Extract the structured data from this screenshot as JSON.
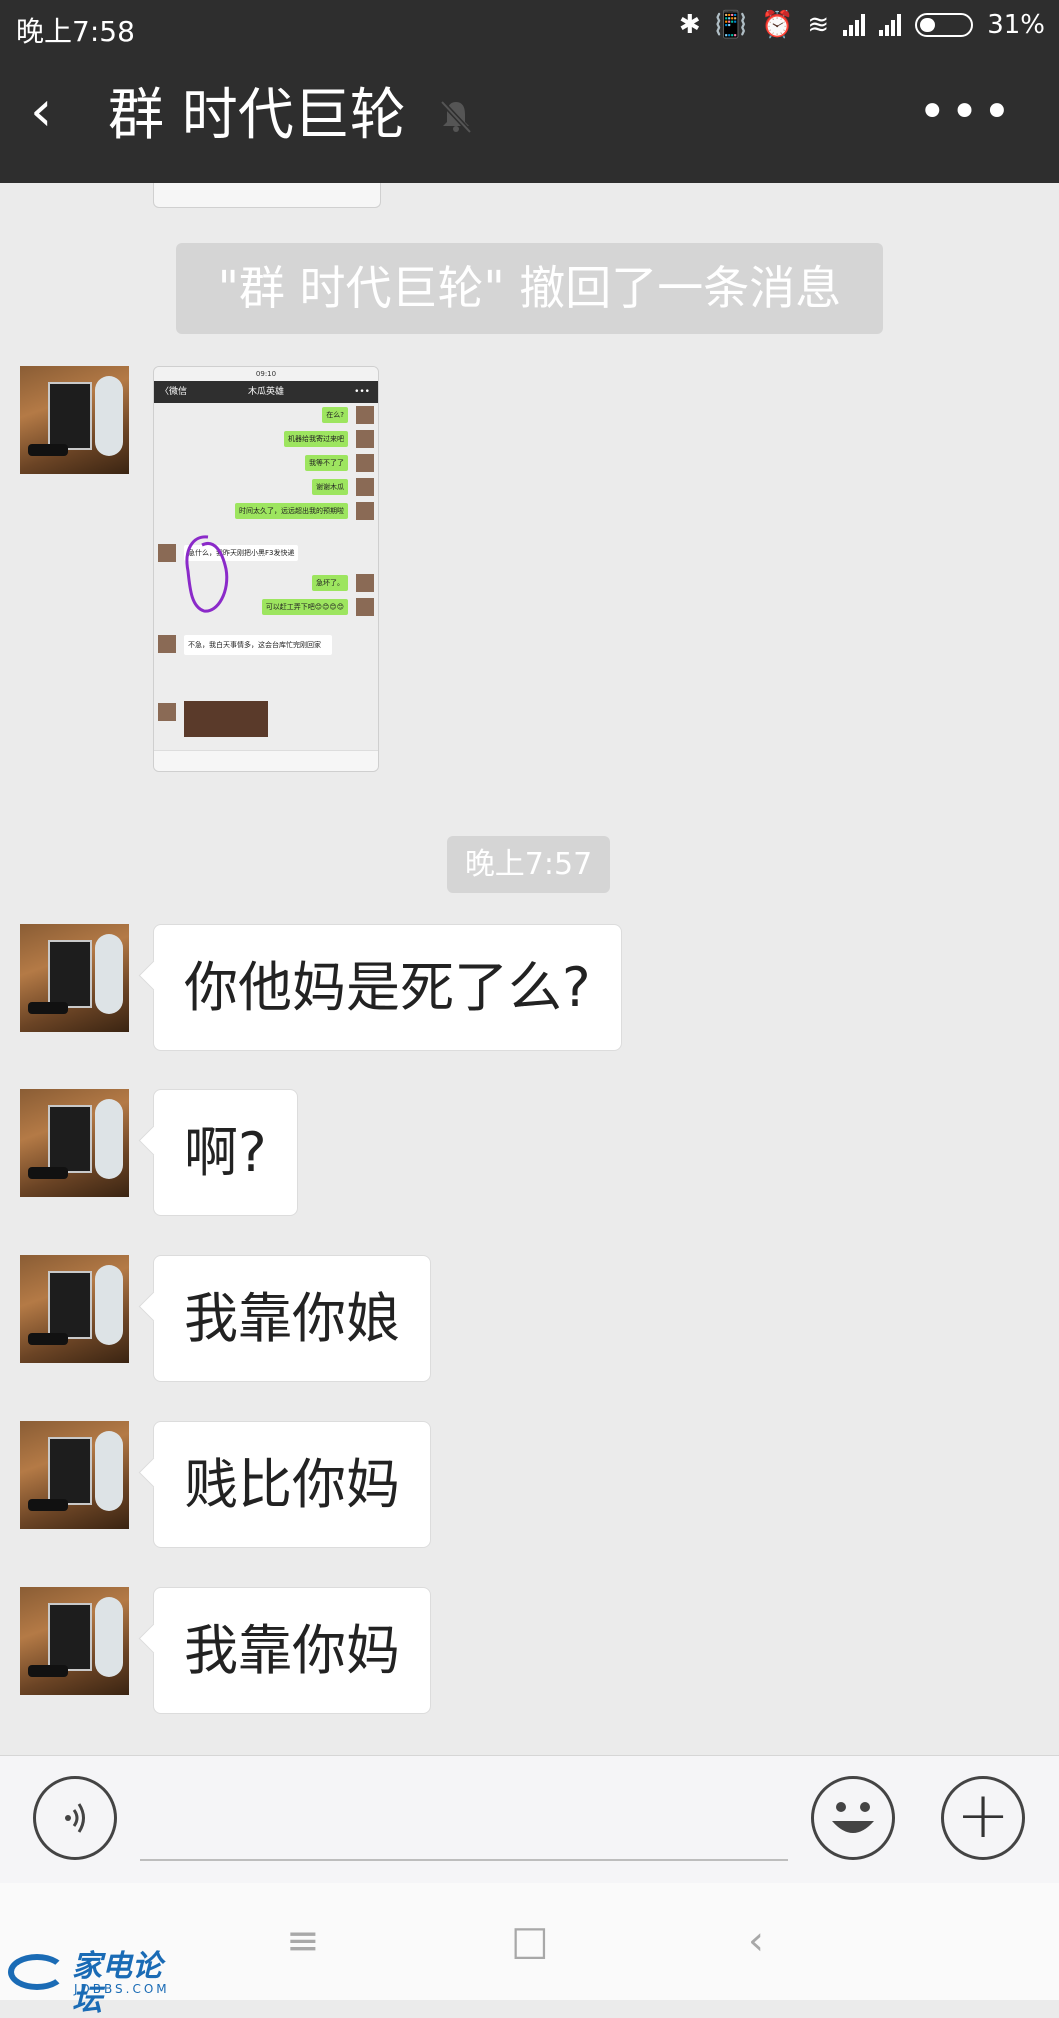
{
  "status_bar": {
    "time": "晚上7:58",
    "battery": "31%",
    "battery_level": 0.31,
    "icons": [
      "bluetooth-icon",
      "vibrate-icon",
      "alarm-icon",
      "wifi-icon",
      "signal-icon",
      "signal-icon",
      "battery-icon"
    ]
  },
  "header": {
    "back_icon": "‹",
    "title": "群 时代巨轮",
    "more_icon": "•••"
  },
  "messages": {
    "recall_notice": "\"群 时代巨轮\" 撤回了一条消息",
    "timestamp": "晚上7:57",
    "texts": [
      {
        "text": "你他妈是死了么?"
      },
      {
        "text": "啊?"
      },
      {
        "text": "我靠你娘"
      },
      {
        "text": "贱比你妈"
      },
      {
        "text": "我靠你妈"
      }
    ]
  },
  "image_message": {
    "status": "09:10",
    "header_back": "〈微信",
    "header_title": "木瓜英雄",
    "header_more": "•••",
    "lines": [
      "在么?",
      "机器给我寄过来吧",
      "我等不了了",
      "谢谢木瓜",
      "时间太久了，远远超出我的预期啦",
      "急什么，我昨天刚把小黑F3发快递",
      "急坏了。",
      "可以赶工弄下吧😊😊😊😊",
      "不急，我白天事情多，这会台库忙完刚回家"
    ]
  },
  "input_bar": {
    "voice_icon": "voice-icon",
    "emoji_icon": "emoji-icon",
    "plus_icon": "+"
  },
  "system_nav": {
    "menu": "≡",
    "home": "□",
    "back": "‹"
  },
  "watermark": {
    "cn": "家电论坛",
    "en": "JDBBS.COM"
  }
}
